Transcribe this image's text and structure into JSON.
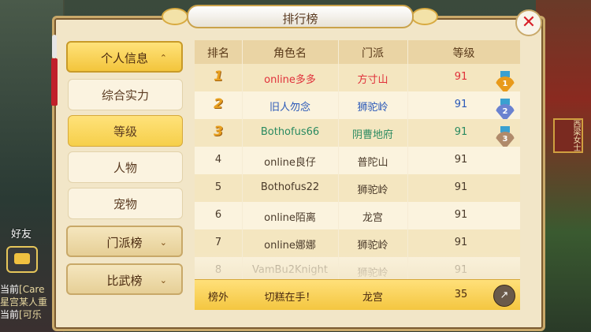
{
  "title": "排行榜",
  "close_label": "✕",
  "sidebar": {
    "personal": "个人信息",
    "personal_chev": "⌃",
    "sub_items": [
      "综合实力",
      "等级",
      "人物",
      "宠物"
    ],
    "sect": "门派榜",
    "sect_chev": "⌄",
    "duel": "比武榜",
    "duel_chev": "⌄"
  },
  "table": {
    "headers": [
      "排名",
      "角色名",
      "门派",
      "等级"
    ],
    "rows": [
      {
        "rank": "1",
        "name": "online多多",
        "sect": "方寸山",
        "level": "91"
      },
      {
        "rank": "2",
        "name": "旧人勿念",
        "sect": "狮驼岭",
        "level": "91"
      },
      {
        "rank": "3",
        "name": "Bothofus66",
        "sect": "阴曹地府",
        "level": "91"
      },
      {
        "rank": "4",
        "name": "online良仔",
        "sect": "普陀山",
        "level": "91"
      },
      {
        "rank": "5",
        "name": "Bothofus22",
        "sect": "狮驼岭",
        "level": "91"
      },
      {
        "rank": "6",
        "name": "online陌离",
        "sect": "龙宫",
        "level": "91"
      },
      {
        "rank": "7",
        "name": "online娜娜",
        "sect": "狮驼岭",
        "level": "91"
      },
      {
        "rank": "8",
        "name": "VamBu2Knight",
        "sect": "狮驼岭",
        "level": "91"
      }
    ],
    "row_colors": [
      "#e0303a",
      "#2a58b8",
      "#2a8a60"
    ],
    "medal_colors": [
      "#e89a1a",
      "#6a82d0",
      "#b08a6a"
    ]
  },
  "mine": {
    "rank": "榜外",
    "name": "切糕在手！",
    "sect": "龙宫",
    "level": "35"
  },
  "share_icon": "↗",
  "background": {
    "friend": "好友",
    "chat_lines": [
      {
        "tag": "当前",
        "text": "[Care"
      },
      {
        "tag": "",
        "text": "星宫某人重"
      },
      {
        "tag": "当前",
        "text": "[可乐"
      }
    ],
    "sign": "西梁女士"
  }
}
